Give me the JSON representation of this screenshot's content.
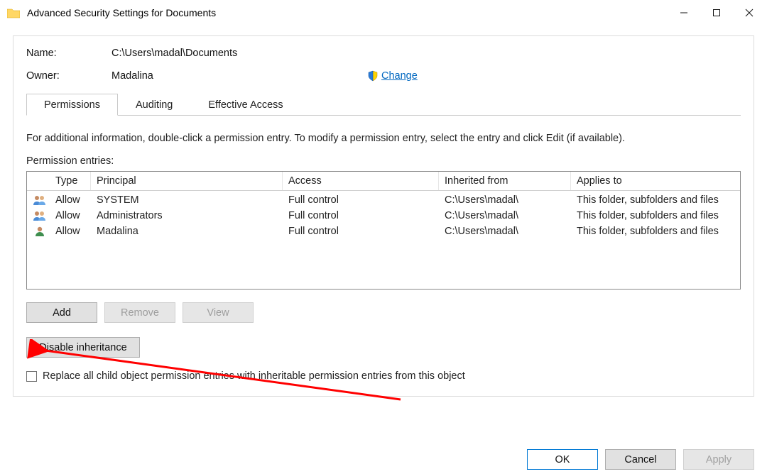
{
  "window": {
    "title": "Advanced Security Settings for Documents"
  },
  "info": {
    "name_label": "Name:",
    "name_value": "C:\\Users\\madal\\Documents",
    "owner_label": "Owner:",
    "owner_value": "Madalina",
    "change_label": "Change"
  },
  "tabs": {
    "permissions": "Permissions",
    "auditing": "Auditing",
    "effective_access": "Effective Access"
  },
  "hint": "For additional information, double-click a permission entry. To modify a permission entry, select the entry and click Edit (if available).",
  "permtable": {
    "heading": "Permission entries:",
    "cols": {
      "type": "Type",
      "principal": "Principal",
      "access": "Access",
      "inherited": "Inherited from",
      "applies": "Applies to"
    },
    "rows": [
      {
        "icon": "group",
        "type": "Allow",
        "principal": "SYSTEM",
        "access": "Full control",
        "inherited": "C:\\Users\\madal\\",
        "applies": "This folder, subfolders and files"
      },
      {
        "icon": "group",
        "type": "Allow",
        "principal": "Administrators",
        "access": "Full control",
        "inherited": "C:\\Users\\madal\\",
        "applies": "This folder, subfolders and files"
      },
      {
        "icon": "user",
        "type": "Allow",
        "principal": "Madalina",
        "access": "Full control",
        "inherited": "C:\\Users\\madal\\",
        "applies": "This folder, subfolders and files"
      }
    ]
  },
  "buttons": {
    "add": "Add",
    "remove": "Remove",
    "view": "View",
    "disable_inherit": "Disable inheritance",
    "ok": "OK",
    "cancel": "Cancel",
    "apply": "Apply"
  },
  "checkbox": {
    "replace_children": "Replace all child object permission entries with inheritable permission entries from this object"
  }
}
